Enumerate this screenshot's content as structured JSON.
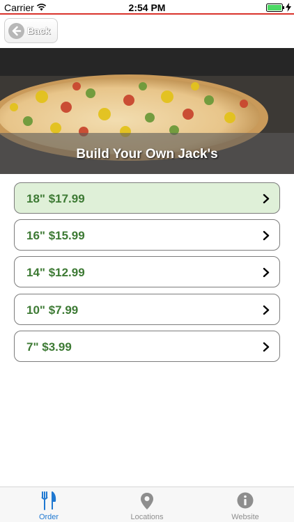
{
  "status_bar": {
    "carrier": "Carrier",
    "time": "2:54 PM"
  },
  "nav": {
    "back_label": "Back"
  },
  "hero": {
    "title": "Build Your Own Jack's"
  },
  "sizes": [
    {
      "label": "18\" $17.99",
      "selected": true
    },
    {
      "label": "16\" $15.99",
      "selected": false
    },
    {
      "label": "14\" $12.99",
      "selected": false
    },
    {
      "label": "10\" $7.99",
      "selected": false
    },
    {
      "label": "7\" $3.99",
      "selected": false
    }
  ],
  "tabs": [
    {
      "label": "Order",
      "icon": "fork-knife-icon",
      "active": true
    },
    {
      "label": "Locations",
      "icon": "location-pin-icon",
      "active": false
    },
    {
      "label": "Website",
      "icon": "info-icon",
      "active": false
    }
  ],
  "colors": {
    "accent_green": "#3d7a34",
    "selected_bg": "#dff0d8",
    "tab_active": "#1f78d1",
    "status_line": "#d9322b",
    "battery": "#4cd964"
  }
}
